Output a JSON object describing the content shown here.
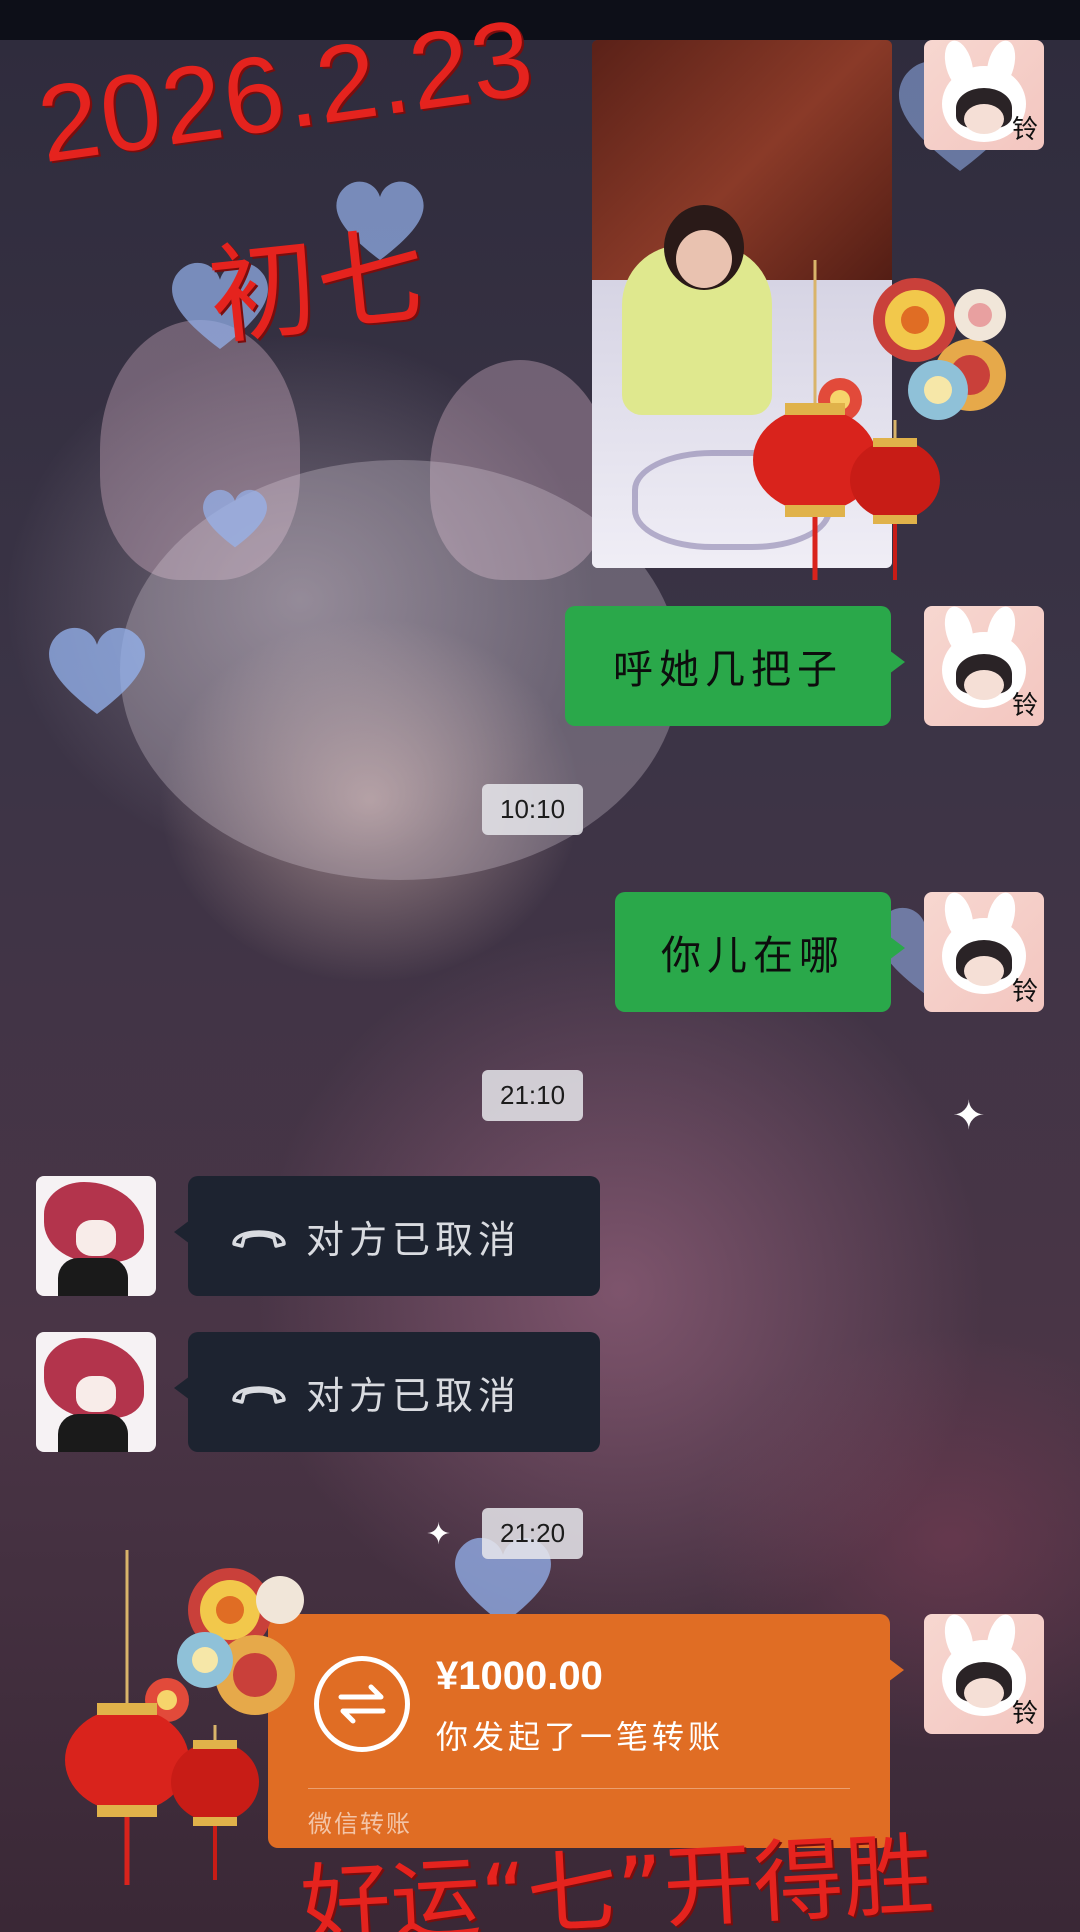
{
  "overlay": {
    "date": "2026.2.23",
    "lunar_day": "初七",
    "slogan": "好运“七”开得胜"
  },
  "avatars": {
    "me_label": "铃"
  },
  "messages": [
    {
      "type": "image",
      "side": "right"
    },
    {
      "type": "text",
      "side": "right",
      "text": "呼她几把子"
    },
    {
      "type": "timestamp",
      "text": "10:10"
    },
    {
      "type": "text",
      "side": "right",
      "text": "你儿在哪"
    },
    {
      "type": "timestamp",
      "text": "21:10"
    },
    {
      "type": "call",
      "side": "left",
      "text": "对方已取消",
      "icon": "phone-hangup-icon"
    },
    {
      "type": "call",
      "side": "left",
      "text": "对方已取消",
      "icon": "phone-hangup-icon"
    },
    {
      "type": "timestamp",
      "text": "21:20"
    },
    {
      "type": "transfer",
      "side": "right",
      "amount": "¥1000.00",
      "description": "你发起了一笔转账",
      "label": "微信转账",
      "icon": "transfer-arrows-icon"
    }
  ],
  "colors": {
    "sent_bubble": "#2aa84a",
    "call_bubble": "#1d2330",
    "transfer_bubble": "#e06d24",
    "overlay_text": "#e5231e"
  }
}
